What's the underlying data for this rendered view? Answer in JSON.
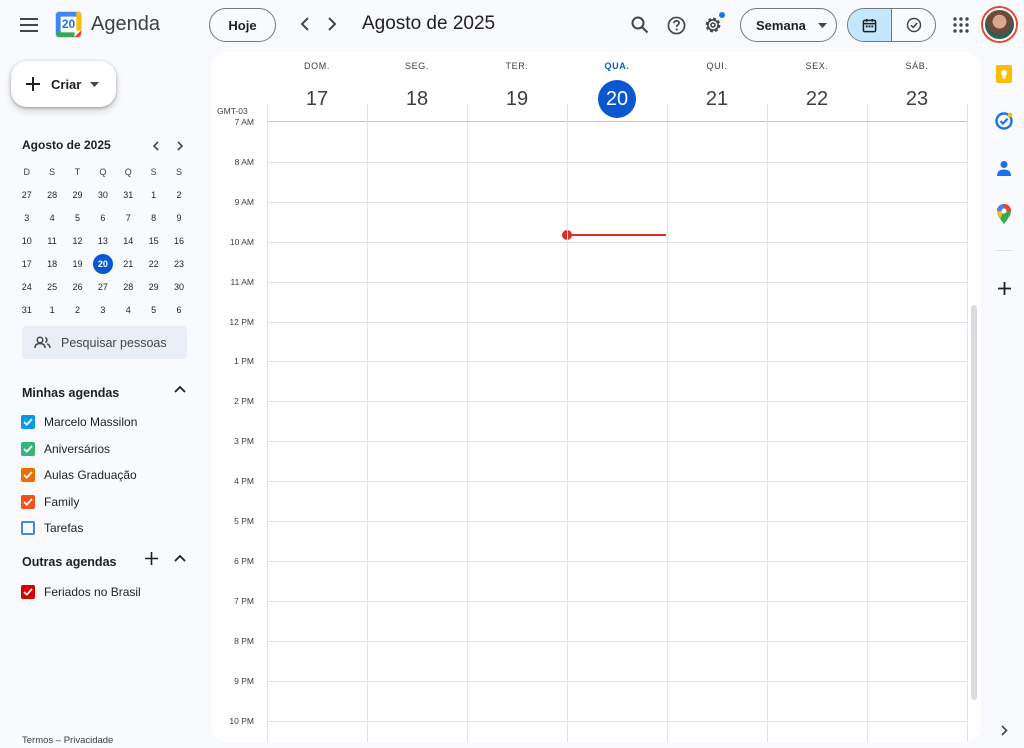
{
  "app": {
    "title": "Agenda",
    "logo_day": "20"
  },
  "toolbar": {
    "today_label": "Hoje",
    "period_title": "Agosto de 2025",
    "view_label": "Semana"
  },
  "sidebar": {
    "create_label": "Criar",
    "mini_calendar": {
      "title": "Agosto de 2025",
      "weekdays": [
        "D",
        "S",
        "T",
        "Q",
        "Q",
        "S",
        "S"
      ],
      "weeks": [
        [
          "27",
          "28",
          "29",
          "30",
          "31",
          "1",
          "2"
        ],
        [
          "3",
          "4",
          "5",
          "6",
          "7",
          "8",
          "9"
        ],
        [
          "10",
          "11",
          "12",
          "13",
          "14",
          "15",
          "16"
        ],
        [
          "17",
          "18",
          "19",
          "20",
          "21",
          "22",
          "23"
        ],
        [
          "24",
          "25",
          "26",
          "27",
          "28",
          "29",
          "30"
        ],
        [
          "31",
          "1",
          "2",
          "3",
          "4",
          "5",
          "6"
        ]
      ],
      "today": "20"
    },
    "people_search_placeholder": "Pesquisar pessoas",
    "my_calendars_title": "Minhas agendas",
    "my_calendars": [
      {
        "label": "Marcelo Massilon",
        "color": "#039be5",
        "checked": true
      },
      {
        "label": "Aniversários",
        "color": "#33b679",
        "checked": true
      },
      {
        "label": "Aulas Graduação",
        "color": "#ef6c00",
        "checked": true
      },
      {
        "label": "Family",
        "color": "#f4511e",
        "checked": true
      },
      {
        "label": "Tarefas",
        "color": "#4285f4",
        "checked": false
      }
    ],
    "other_calendars_title": "Outras agendas",
    "other_calendars": [
      {
        "label": "Feriados no Brasil",
        "color": "#d50000",
        "checked": true
      }
    ],
    "footer": "Termos – Privacidade"
  },
  "week": {
    "timezone": "GMT-03",
    "days": [
      {
        "dow": "DOM.",
        "num": "17",
        "current": false
      },
      {
        "dow": "SEG.",
        "num": "18",
        "current": false
      },
      {
        "dow": "TER.",
        "num": "19",
        "current": false
      },
      {
        "dow": "QUA.",
        "num": "20",
        "current": true
      },
      {
        "dow": "QUI.",
        "num": "21",
        "current": false
      },
      {
        "dow": "SEX.",
        "num": "22",
        "current": false
      },
      {
        "dow": "SÁB.",
        "num": "23",
        "current": false
      }
    ],
    "hours": [
      "7 AM",
      "8 AM",
      "9 AM",
      "10 AM",
      "11 AM",
      "12 PM",
      "1 PM",
      "2 PM",
      "3 PM",
      "4 PM",
      "5 PM",
      "6 PM",
      "7 PM",
      "8 PM",
      "9 PM",
      "10 PM"
    ]
  },
  "colors": {
    "accent": "#0b57d0",
    "now_indicator": "#d93025"
  }
}
